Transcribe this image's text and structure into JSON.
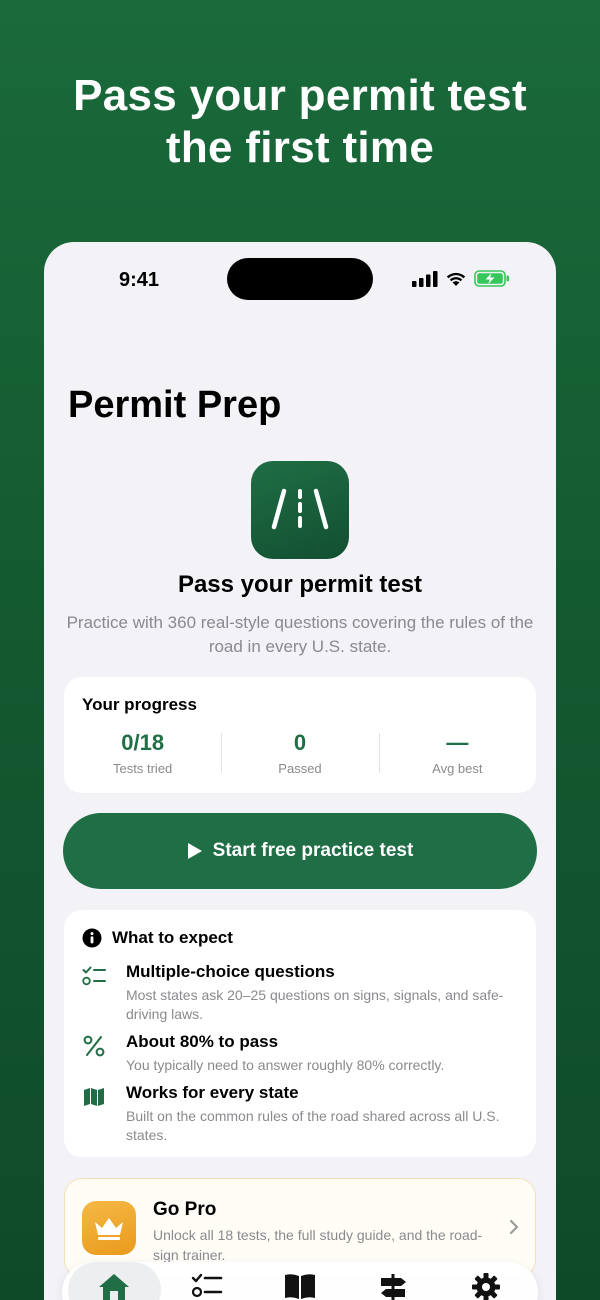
{
  "promo": {
    "headline_line1": "Pass your permit test",
    "headline_line2": "the first time"
  },
  "status_bar": {
    "time": "9:41"
  },
  "app": {
    "title": "Permit Prep",
    "hero_title": "Pass your permit test",
    "hero_subtitle": "Practice with 360 real-style questions covering the rules of the road in every U.S. state."
  },
  "progress": {
    "title": "Your progress",
    "stats": [
      {
        "value": "0/18",
        "label": "Tests tried"
      },
      {
        "value": "0",
        "label": "Passed"
      },
      {
        "value": "—",
        "label": "Avg best"
      }
    ]
  },
  "cta": {
    "label": "Start free practice test"
  },
  "expect": {
    "title": "What to expect",
    "items": [
      {
        "title": "Multiple-choice questions",
        "desc": "Most states ask 20–25 questions on signs, signals, and safe-driving laws.",
        "icon": "checklist-icon"
      },
      {
        "title": "About 80% to pass",
        "desc": "You typically need to answer roughly 80% correctly.",
        "icon": "percent-icon"
      },
      {
        "title": "Works for every state",
        "desc": "Built on the common rules of the road shared across all U.S. states.",
        "icon": "map-icon"
      }
    ]
  },
  "pro": {
    "title": "Go Pro",
    "desc": "Unlock all 18 tests, the full study guide, and the road-sign trainer."
  },
  "tabs": [
    {
      "icon": "home-icon",
      "active": true
    },
    {
      "icon": "list-icon",
      "active": false
    },
    {
      "icon": "book-icon",
      "active": false
    },
    {
      "icon": "signpost-icon",
      "active": false
    },
    {
      "icon": "gear-icon",
      "active": false
    }
  ],
  "colors": {
    "brand_green": "#1f6e45",
    "background_green": "#145a31",
    "pro_gold": "#f0a82c"
  }
}
